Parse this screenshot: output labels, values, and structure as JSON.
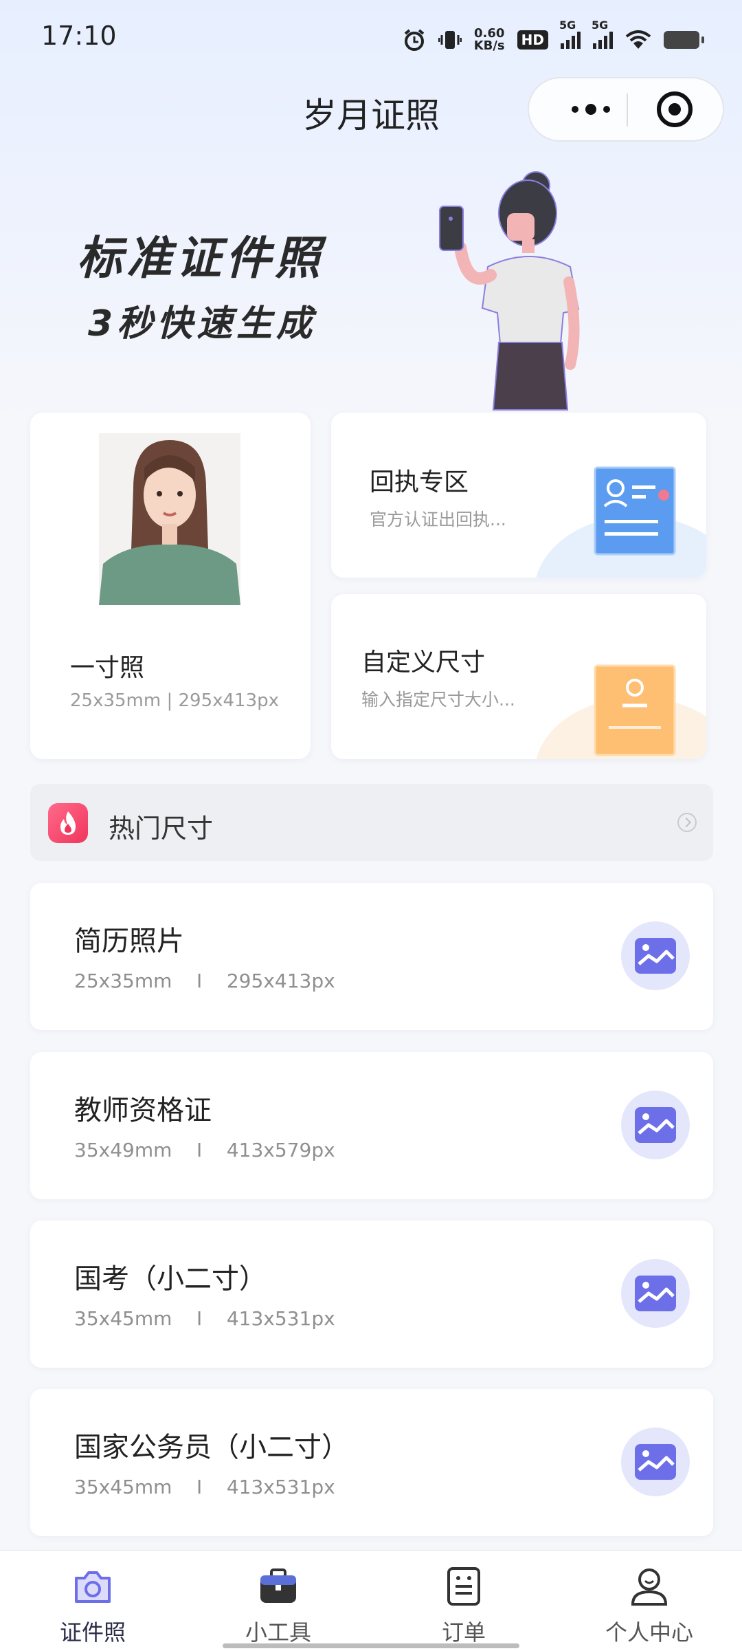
{
  "status_bar": {
    "time": "17:10",
    "net_speed_value": "0.60",
    "net_speed_unit": "KB/s",
    "hd_label": "HD",
    "sim1_label": "5G",
    "sim2_label": "5G"
  },
  "header": {
    "title": "岁月证照"
  },
  "banner": {
    "line1": "标准证件照",
    "line2": "3秒快速生成"
  },
  "main_card": {
    "name": "一寸照",
    "spec": "25x35mm | 295x413px"
  },
  "receipt_card": {
    "name": "回执专区",
    "desc": "官方认证出回执..."
  },
  "custom_card": {
    "name": "自定义尺寸",
    "desc": "输入指定尺寸大小..."
  },
  "hot_section": {
    "label": "热门尺寸"
  },
  "sizes": [
    {
      "title": "简历照片",
      "mm": "25x35mm",
      "px": "295x413px"
    },
    {
      "title": "教师资格证",
      "mm": "35x49mm",
      "px": "413x579px"
    },
    {
      "title": "国考（小二寸）",
      "mm": "35x45mm",
      "px": "413x531px"
    },
    {
      "title": "国家公务员（小二寸）",
      "mm": "35x45mm",
      "px": "413x531px"
    }
  ],
  "tabs": [
    {
      "label": "证件照",
      "icon": "camera-icon",
      "active": true
    },
    {
      "label": "小工具",
      "icon": "toolbox-icon",
      "active": false
    },
    {
      "label": "订单",
      "icon": "order-icon",
      "active": false
    },
    {
      "label": "个人中心",
      "icon": "user-icon",
      "active": false
    }
  ],
  "colors": {
    "accent": "#6c6fe8",
    "hot": "#f0355c",
    "receipt_blue": "#5b9cf0",
    "custom_orange": "#ffb766"
  }
}
